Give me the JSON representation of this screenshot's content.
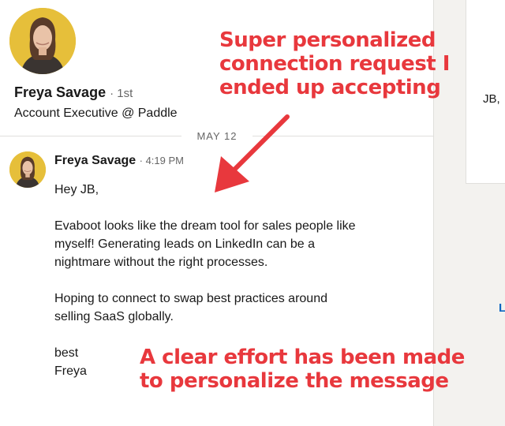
{
  "profile": {
    "name": "Freya Savage",
    "degree": "· 1st",
    "headline": "Account Executive @ Paddle"
  },
  "conversation": {
    "date": "MAY 12",
    "message": {
      "sender": "Freya Savage",
      "time": "· 4:19 PM",
      "paragraphs": [
        "Hey JB,",
        "Evaboot looks like the dream tool for sales people like\nmyself! Generating leads on LinkedIn can be a\nnightmare without the right processes.",
        "Hoping to connect to swap best practices around\nselling SaaS globally.",
        "best\nFreya"
      ]
    }
  },
  "annotations": {
    "top": "Super personalized\nconnection request I\nended up accepting",
    "bottom": "A clear effort has been made\nto personalize the message"
  },
  "right_panel": {
    "greeting": "JB,",
    "link": "L"
  },
  "colors": {
    "annotation": "#e8383d",
    "avatar_bg": "#e6bf3a",
    "link": "#0a66c2"
  }
}
